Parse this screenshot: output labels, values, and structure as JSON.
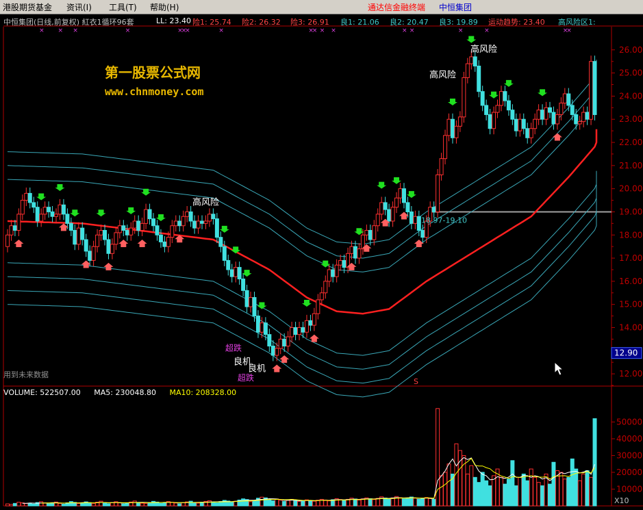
{
  "menubar": {
    "items": [
      "港股期货基金",
      "资讯(I)",
      "工具(T)",
      "帮助(H)"
    ],
    "tongda": "通达信金融终端",
    "company": "中恒集团"
  },
  "info": {
    "title": "中恒集团(日线,前复权) 紅衣1循环96套",
    "ll": "LL: 23.40",
    "items": [
      {
        "text": "险1: 25.74",
        "color": "#ff4444"
      },
      {
        "text": "险2: 26.32",
        "color": "#ff4444"
      },
      {
        "text": "险3: 26.91",
        "color": "#ff4444"
      },
      {
        "text": "良1: 21.06",
        "color": "#40c8c8"
      },
      {
        "text": "良2: 20.47",
        "color": "#40c8c8"
      },
      {
        "text": "良3: 19.89",
        "color": "#40c8c8"
      },
      {
        "text": "运动趋势: 23.40",
        "color": "#ff4444"
      },
      {
        "text": "高风险区1:",
        "color": "#40c8c8"
      }
    ]
  },
  "watermark": {
    "line1": "第一股票公式网",
    "line2": "www.chnmoney.com"
  },
  "labels": {
    "high_risk": "高风险",
    "range": "18.97-19.10",
    "future_data": "用到未来数据",
    "buy": "良机",
    "cross": "超跌",
    "price_box": "12.90",
    "x10": "X10",
    "s_mark": "S"
  },
  "volume": {
    "vol": "VOLUME: 522507.00",
    "ma5": "MA5: 230048.80",
    "ma10": "MA10: 208328.00"
  },
  "colors": {
    "up": "#ff3030",
    "down": "#40e0e0",
    "band": "#3aa8b8",
    "trend": "#ff2020",
    "ma5": "#ffffff",
    "ma10": "#ffff00"
  },
  "chart_data": {
    "type": "candlestick",
    "y_ticks": [
      12,
      13,
      14,
      15,
      16,
      17,
      18,
      19,
      20,
      21,
      22,
      23,
      24,
      25,
      26
    ],
    "y_range": [
      11.5,
      27
    ],
    "vol_ticks": [
      10000,
      20000,
      30000,
      40000,
      50000
    ],
    "vol_range": [
      0,
      62000
    ],
    "ref_line": 19.0,
    "trend": [
      [
        0,
        18.6
      ],
      [
        20,
        18.5
      ],
      [
        40,
        18.1
      ],
      [
        55,
        17.8
      ],
      [
        70,
        16.5
      ],
      [
        80,
        15.3
      ],
      [
        88,
        14.7
      ],
      [
        95,
        14.6
      ],
      [
        102,
        14.8
      ],
      [
        112,
        16.0
      ],
      [
        125,
        17.3
      ],
      [
        140,
        18.8
      ],
      [
        150,
        20.5
      ],
      [
        158,
        22.0
      ],
      [
        165,
        23.0
      ],
      [
        172,
        23.6
      ],
      [
        180,
        23.6
      ],
      [
        195,
        23.4
      ],
      [
        210,
        23.4
      ]
    ],
    "candles": [
      [
        0,
        17.5,
        18.0
      ],
      [
        1,
        18.0,
        18.4
      ],
      [
        2,
        18.4,
        18.2
      ],
      [
        3,
        18.2,
        18.9
      ],
      [
        4,
        18.9,
        19.5
      ],
      [
        5,
        19.5,
        19.8
      ],
      [
        6,
        19.8,
        19.4
      ],
      [
        7,
        19.4,
        19.2
      ],
      [
        8,
        19.2,
        18.6
      ],
      [
        9,
        18.6,
        18.9
      ],
      [
        10,
        18.9,
        19.2
      ],
      [
        11,
        19.2,
        19.0
      ],
      [
        12,
        19.0,
        18.8
      ],
      [
        13,
        18.8,
        18.9
      ],
      [
        14,
        18.9,
        19.3
      ],
      [
        15,
        19.3,
        18.9
      ],
      [
        16,
        18.9,
        18.5
      ],
      [
        17,
        18.5,
        18.2
      ],
      [
        18,
        18.2,
        17.6
      ],
      [
        19,
        17.6,
        18.3
      ],
      [
        20,
        18.3,
        17.8
      ],
      [
        21,
        17.8,
        17.3
      ],
      [
        22,
        17.3,
        16.9
      ],
      [
        23,
        16.9,
        17.5
      ],
      [
        24,
        17.5,
        18.0
      ],
      [
        25,
        18.0,
        18.2
      ],
      [
        26,
        18.2,
        17.8
      ],
      [
        27,
        17.8,
        17.2
      ],
      [
        28,
        17.2,
        17.6
      ],
      [
        29,
        17.6,
        18.1
      ],
      [
        30,
        18.1,
        18.4
      ],
      [
        31,
        18.4,
        18.2
      ],
      [
        32,
        18.2,
        18.0
      ],
      [
        33,
        18.0,
        18.3
      ],
      [
        34,
        18.3,
        18.6
      ],
      [
        35,
        18.6,
        18.2
      ],
      [
        36,
        18.2,
        18.5
      ],
      [
        37,
        18.5,
        19.1
      ],
      [
        38,
        19.1,
        18.7
      ],
      [
        39,
        18.7,
        18.4
      ],
      [
        40,
        18.4,
        18.0
      ],
      [
        41,
        18.0,
        17.7
      ],
      [
        42,
        17.7,
        17.5
      ],
      [
        43,
        17.5,
        17.9
      ],
      [
        44,
        17.9,
        18.4
      ],
      [
        45,
        18.4,
        18.6
      ],
      [
        46,
        18.6,
        18.4
      ],
      [
        47,
        18.4,
        18.8
      ],
      [
        48,
        18.8,
        19.0
      ],
      [
        49,
        19.0,
        18.6
      ],
      [
        50,
        18.6,
        18.3
      ],
      [
        51,
        18.3,
        18.6
      ],
      [
        52,
        18.6,
        18.5
      ],
      [
        53,
        18.5,
        18.6
      ],
      [
        54,
        18.6,
        18.9
      ],
      [
        55,
        18.9,
        18.7
      ],
      [
        56,
        18.7,
        17.9
      ],
      [
        57,
        17.9,
        17.5
      ],
      [
        58,
        17.5,
        16.9
      ],
      [
        59,
        16.9,
        16.5
      ],
      [
        60,
        16.5,
        16.2
      ],
      [
        61,
        16.2,
        16.6
      ],
      [
        62,
        16.6,
        16.1
      ],
      [
        63,
        16.1,
        15.6
      ],
      [
        64,
        15.6,
        14.9
      ],
      [
        65,
        14.9,
        15.3
      ],
      [
        66,
        15.3,
        14.5
      ],
      [
        67,
        14.5,
        13.8
      ],
      [
        68,
        13.8,
        14.2
      ],
      [
        69,
        14.2,
        13.7
      ],
      [
        70,
        13.7,
        13.2
      ],
      [
        71,
        13.2,
        12.8
      ],
      [
        72,
        12.8,
        13.1
      ],
      [
        73,
        13.1,
        13.5
      ],
      [
        74,
        13.5,
        13.2
      ],
      [
        75,
        13.2,
        13.6
      ],
      [
        76,
        13.6,
        14.0
      ],
      [
        77,
        14.0,
        13.7
      ],
      [
        78,
        13.7,
        14.0
      ],
      [
        79,
        14.0,
        13.8
      ],
      [
        80,
        13.8,
        14.3
      ],
      [
        81,
        14.3,
        14.1
      ],
      [
        82,
        14.1,
        14.6
      ],
      [
        83,
        14.6,
        15.2
      ],
      [
        84,
        15.2,
        15.5
      ],
      [
        85,
        15.5,
        16.0
      ],
      [
        86,
        16.0,
        16.5
      ],
      [
        87,
        16.5,
        16.2
      ],
      [
        88,
        16.2,
        16.7
      ],
      [
        89,
        16.7,
        16.9
      ],
      [
        90,
        16.9,
        16.6
      ],
      [
        91,
        16.6,
        17.2
      ],
      [
        92,
        17.2,
        17.5
      ],
      [
        93,
        17.5,
        17.0
      ],
      [
        94,
        17.0,
        17.4
      ],
      [
        95,
        17.4,
        18.0
      ],
      [
        96,
        18.0,
        18.2
      ],
      [
        97,
        18.2,
        17.8
      ],
      [
        98,
        17.8,
        18.4
      ],
      [
        99,
        18.4,
        18.9
      ],
      [
        100,
        18.9,
        19.4
      ],
      [
        101,
        19.4,
        19.1
      ],
      [
        102,
        19.1,
        18.6
      ],
      [
        103,
        18.6,
        19.2
      ],
      [
        104,
        19.2,
        19.6
      ],
      [
        105,
        19.6,
        20.0
      ],
      [
        106,
        20.0,
        19.4
      ],
      [
        107,
        19.4,
        19.0
      ],
      [
        108,
        19.0,
        18.5
      ],
      [
        109,
        18.5,
        18.8
      ],
      [
        110,
        18.8,
        18.2
      ],
      [
        111,
        18.2,
        17.9
      ],
      [
        112,
        17.9,
        18.6
      ],
      [
        113,
        18.6,
        19.2
      ],
      [
        114,
        19.2,
        19.0
      ],
      [
        115,
        19.0,
        20.6
      ],
      [
        116,
        20.6,
        21.3
      ],
      [
        117,
        21.3,
        22.3
      ],
      [
        118,
        22.3,
        23.0
      ],
      [
        119,
        23.0,
        22.2
      ],
      [
        120,
        22.2,
        22.7
      ],
      [
        121,
        22.7,
        23.1
      ],
      [
        122,
        23.1,
        24.8
      ],
      [
        123,
        24.8,
        25.4
      ],
      [
        124,
        25.4,
        25.7
      ],
      [
        125,
        25.7,
        25.3
      ],
      [
        126,
        25.3,
        24.2
      ],
      [
        127,
        24.2,
        23.6
      ],
      [
        128,
        23.6,
        23.2
      ],
      [
        129,
        23.2,
        22.6
      ],
      [
        130,
        22.6,
        23.3
      ],
      [
        131,
        23.3,
        23.6
      ],
      [
        132,
        23.6,
        24.2
      ],
      [
        133,
        24.2,
        23.8
      ],
      [
        134,
        23.8,
        23.4
      ],
      [
        135,
        23.4,
        23.0
      ],
      [
        136,
        23.0,
        22.5
      ],
      [
        137,
        22.5,
        23.0
      ],
      [
        138,
        23.0,
        22.6
      ],
      [
        139,
        22.6,
        22.2
      ],
      [
        140,
        22.2,
        22.6
      ],
      [
        141,
        22.6,
        23.0
      ],
      [
        142,
        23.0,
        23.4
      ],
      [
        143,
        23.4,
        23.0
      ],
      [
        144,
        23.0,
        23.5
      ],
      [
        145,
        23.5,
        23.3
      ],
      [
        146,
        23.3,
        22.8
      ],
      [
        147,
        22.8,
        23.2
      ],
      [
        148,
        23.2,
        23.7
      ],
      [
        149,
        23.7,
        24.1
      ],
      [
        150,
        24.1,
        23.6
      ],
      [
        151,
        23.6,
        23.2
      ],
      [
        152,
        23.2,
        22.8
      ],
      [
        153,
        22.8,
        22.9
      ],
      [
        154,
        22.9,
        23.3
      ],
      [
        155,
        23.3,
        23.0
      ],
      [
        156,
        23.0,
        25.5
      ],
      [
        157,
        25.5,
        23.2
      ]
    ],
    "volumes": [
      1200,
      900,
      1500,
      2200,
      1800,
      1400,
      1600,
      1100,
      2000,
      2500,
      1700,
      1300,
      1900,
      2300,
      1500,
      1000,
      1800,
      2600,
      2100,
      1400,
      1700,
      2400,
      1900,
      1500,
      2200,
      2800,
      1600,
      1300,
      2000,
      2500,
      1800,
      1200,
      1700,
      2300,
      2900,
      2100,
      1600,
      1400,
      2000,
      2700,
      2300,
      1500,
      1800,
      2600,
      2200,
      1700,
      1300,
      1900,
      2400,
      2800,
      2000,
      1600,
      2200,
      2700,
      3100,
      2400,
      1800,
      2600,
      3300,
      2900,
      2200,
      2800,
      3500,
      4200,
      3800,
      2500,
      3200,
      4600,
      5200,
      4800,
      3600,
      3000,
      4100,
      3400,
      2700,
      3300,
      3900,
      3100,
      2600,
      3000,
      3600,
      3200,
      2800,
      3400,
      3900,
      3500,
      3000,
      3700,
      4300,
      3800,
      3300,
      3900,
      4600,
      4100,
      3500,
      4200,
      4800,
      4300,
      3800,
      4500,
      5400,
      4700,
      4100,
      4800,
      5600,
      4900,
      4200,
      4700,
      5300,
      4600,
      4000,
      4500,
      5000,
      4400,
      3900,
      58000,
      18000,
      20000,
      25000,
      19000,
      37000,
      33000,
      30000,
      19000,
      24000,
      17000,
      14000,
      20000,
      15000,
      12000,
      18000,
      22000,
      17000,
      13000,
      16000,
      27000,
      12000,
      17000,
      19000,
      15000,
      22000,
      17000,
      14000,
      12000,
      19000,
      13000,
      26000,
      21000,
      20000,
      16000,
      17000,
      28000,
      22000,
      15000,
      19000,
      21000,
      17000,
      52000
    ]
  }
}
